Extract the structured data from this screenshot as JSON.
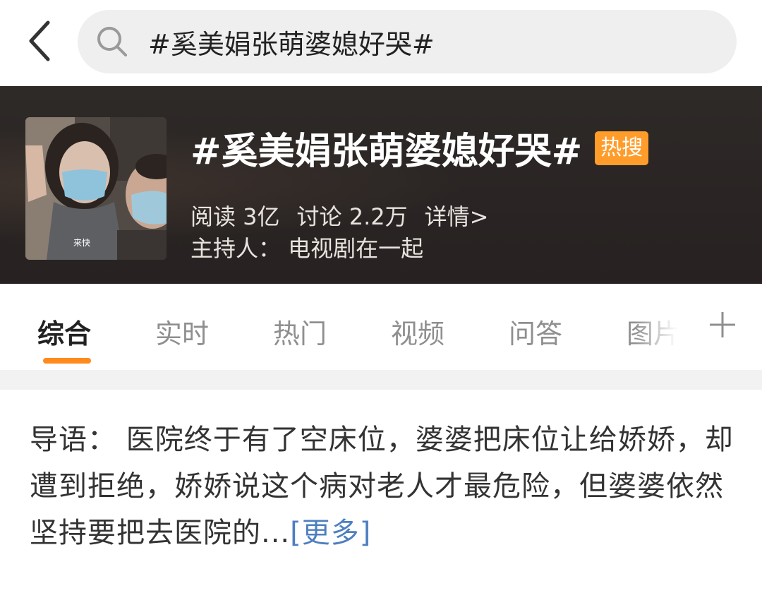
{
  "search": {
    "query": "#奚美娟张萌婆媳好哭#"
  },
  "topic": {
    "title": "#奚美娟张萌婆媳好哭#",
    "badge": "热搜",
    "cover_caption": "来快",
    "reads": "阅读 3亿",
    "discussions": "讨论 2.2万",
    "detail": "详情>",
    "host": "主持人：  电视剧在一起"
  },
  "tabs": [
    {
      "label": "综合",
      "active": true
    },
    {
      "label": "实时",
      "active": false
    },
    {
      "label": "热门",
      "active": false
    },
    {
      "label": "视频",
      "active": false
    },
    {
      "label": "问答",
      "active": false
    },
    {
      "label": "图片",
      "active": false
    }
  ],
  "intro": {
    "text": "导语：  医院终于有了空床位，婆婆把床位让给娇娇，却遭到拒绝，娇娇说这个病对老人才最危险，但婆婆依然坚持要把去医院的...",
    "more": "[更多]"
  },
  "colors": {
    "accent": "#ff8a1e",
    "badge": "#ff9c2a",
    "link": "#4e7fc0",
    "header_bg": "#2b2625"
  },
  "icons": {
    "back": "chevron-left-icon",
    "search": "search-icon",
    "add": "plus-icon"
  }
}
